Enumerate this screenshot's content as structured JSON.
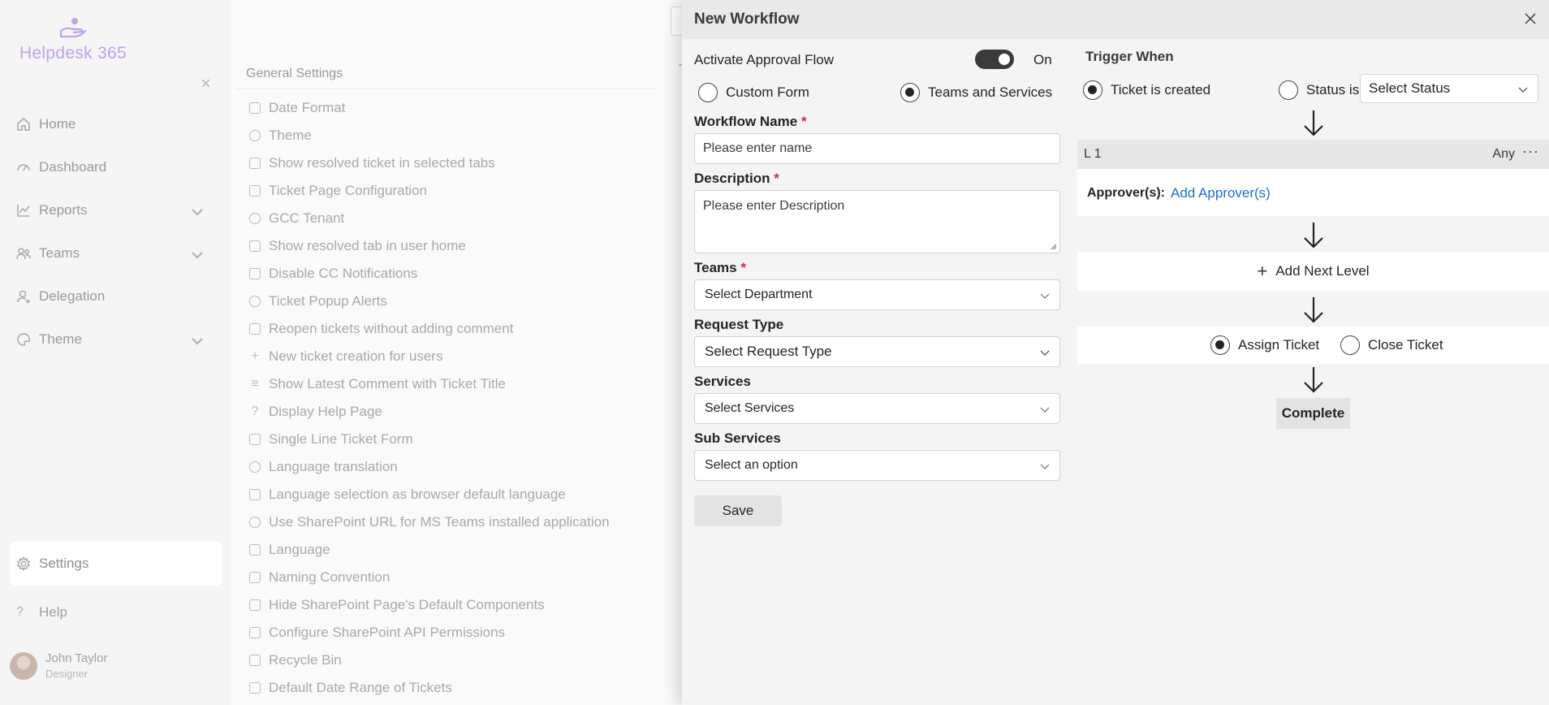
{
  "app": {
    "title": "Helpdesk 365"
  },
  "sidebar": {
    "items": [
      {
        "label": "Home",
        "icon": "home-icon"
      },
      {
        "label": "Dashboard",
        "icon": "dashboard-icon"
      },
      {
        "label": "Reports",
        "icon": "reports-icon",
        "expandable": true
      },
      {
        "label": "Teams",
        "icon": "teams-icon",
        "expandable": true
      },
      {
        "label": "Delegation",
        "icon": "delegation-icon"
      },
      {
        "label": "Theme",
        "icon": "theme-icon",
        "expandable": true
      }
    ],
    "settings_label": "Settings",
    "help_label": "Help",
    "user": {
      "name": "John Taylor",
      "role": "Designer"
    }
  },
  "general_settings": {
    "title": "General Settings",
    "items": [
      "Date Format",
      "Theme",
      "Show resolved ticket in selected tabs",
      "Ticket Page Configuration",
      "GCC Tenant",
      "Show resolved tab in user home",
      "Disable CC Notifications",
      "Ticket Popup Alerts",
      "Reopen tickets without adding comment",
      "New ticket creation for users",
      "Show Latest Comment with Ticket Title",
      "Display Help Page",
      "Single Line Ticket Form",
      "Language translation",
      "Language selection as browser default language",
      "Use SharePoint URL for MS Teams installed application",
      "Language",
      "Naming Convention",
      "Hide SharePoint Page's Default Components",
      "Configure SharePoint API Permissions",
      "Recycle Bin",
      "Default Date Range of Tickets"
    ]
  },
  "panel": {
    "title": "New Workflow",
    "approval_flow": {
      "label": "Activate Approval Flow",
      "state_label": "On",
      "enabled": true
    },
    "scope_options": {
      "custom_form": "Custom Form",
      "teams_services": "Teams and Services",
      "selected": "teams_services"
    },
    "workflow_name": {
      "label": "Workflow Name",
      "required_mark": "*",
      "placeholder": "Please enter name"
    },
    "description": {
      "label": "Description",
      "required_mark": "*",
      "placeholder": "Please enter Description"
    },
    "teams": {
      "label": "Teams",
      "required_mark": "*",
      "value": "Select Department"
    },
    "request_type": {
      "label": "Request Type",
      "value": "Select Request Type"
    },
    "services": {
      "label": "Services",
      "value": "Select Services"
    },
    "sub_services": {
      "label": "Sub Services",
      "value": "Select an option"
    },
    "save_label": "Save",
    "trigger": {
      "title": "Trigger When",
      "ticket_created": "Ticket is created",
      "status_is": "Status is",
      "status_select": "Select Status",
      "selected": "ticket_created"
    },
    "level": {
      "name": "L 1",
      "mode": "Any",
      "more": "···",
      "approvers_label": "Approver(s):",
      "add_approvers": "Add Approver(s)"
    },
    "add_next_level": "Add Next Level",
    "actions": {
      "assign": "Assign Ticket",
      "close": "Close Ticket",
      "selected": "assign"
    },
    "complete_label": "Complete"
  },
  "colors": {
    "accent_logo": "#c0a3e8",
    "link": "#1e6fc4",
    "required": "#c4314b",
    "toggle_on": "#3b3b3b"
  }
}
